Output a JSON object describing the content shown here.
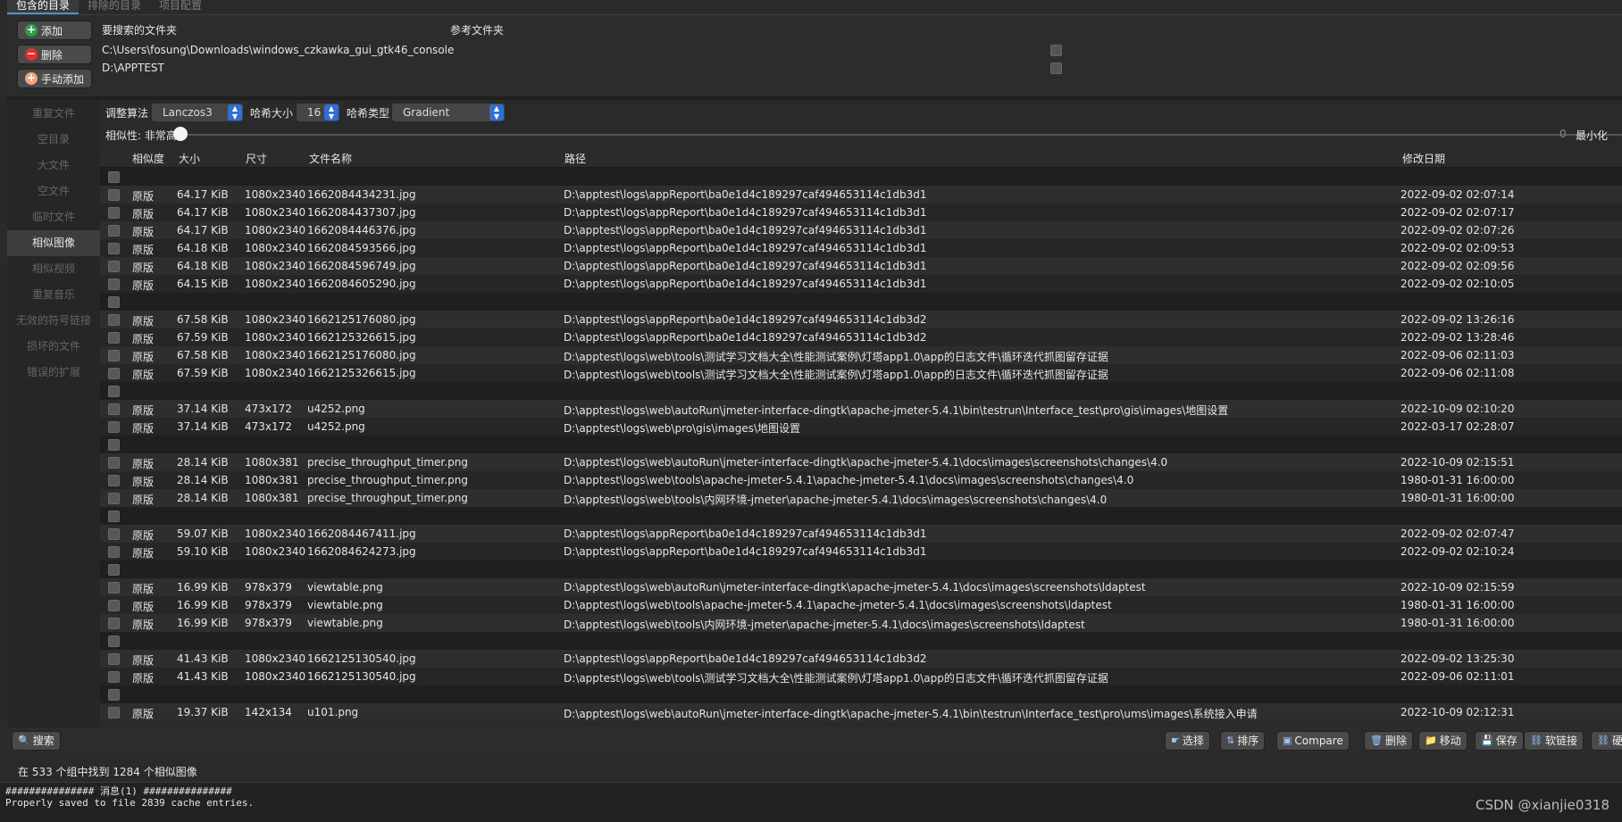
{
  "tabs": [
    "包含的目录",
    "排除的目录",
    "项目配置"
  ],
  "top": {
    "buttons": {
      "add": "添加",
      "remove": "删除",
      "manual_add": "手动添加"
    },
    "col_search": "要搜索的文件夹",
    "col_ref": "参考文件夹",
    "folders": [
      "C:\\Users\\fosung\\Downloads\\windows_czkawka_gui_gtk46_console",
      "D:\\APPTEST"
    ]
  },
  "sidebar": [
    "重复文件",
    "空目录",
    "大文件",
    "空文件",
    "临时文件",
    "相似图像",
    "相似视频",
    "重复音乐",
    "无效的符号链接",
    "损坏的文件",
    "错误的扩展"
  ],
  "options": {
    "resize_label": "调整算法",
    "resize_value": "Lanczos3",
    "hash_size_label": "哈希大小",
    "hash_size_value": "16",
    "hash_type_label": "哈希类型",
    "hash_type_value": "Gradient",
    "similarity_label": "相似性: 非常高",
    "slider_value": "0",
    "minimize_label": "最小化"
  },
  "columns": [
    "相似度",
    "大小",
    "尺寸",
    "文件名称",
    "路径",
    "修改日期"
  ],
  "rows": [
    {
      "h": true
    },
    {
      "sim": "原版",
      "size": "64.17 KiB",
      "dim": "1080x2340",
      "name": "1662084434231.jpg",
      "path": "D:\\apptest\\logs\\appReport\\ba0e1d4c189297caf494653114c1db3d1",
      "date": "2022-09-02 02:07:14"
    },
    {
      "sim": "原版",
      "size": "64.17 KiB",
      "dim": "1080x2340",
      "name": "1662084437307.jpg",
      "path": "D:\\apptest\\logs\\appReport\\ba0e1d4c189297caf494653114c1db3d1",
      "date": "2022-09-02 02:07:17"
    },
    {
      "sim": "原版",
      "size": "64.17 KiB",
      "dim": "1080x2340",
      "name": "1662084446376.jpg",
      "path": "D:\\apptest\\logs\\appReport\\ba0e1d4c189297caf494653114c1db3d1",
      "date": "2022-09-02 02:07:26"
    },
    {
      "sim": "原版",
      "size": "64.18 KiB",
      "dim": "1080x2340",
      "name": "1662084593566.jpg",
      "path": "D:\\apptest\\logs\\appReport\\ba0e1d4c189297caf494653114c1db3d1",
      "date": "2022-09-02 02:09:53"
    },
    {
      "sim": "原版",
      "size": "64.18 KiB",
      "dim": "1080x2340",
      "name": "1662084596749.jpg",
      "path": "D:\\apptest\\logs\\appReport\\ba0e1d4c189297caf494653114c1db3d1",
      "date": "2022-09-02 02:09:56"
    },
    {
      "sim": "原版",
      "size": "64.15 KiB",
      "dim": "1080x2340",
      "name": "1662084605290.jpg",
      "path": "D:\\apptest\\logs\\appReport\\ba0e1d4c189297caf494653114c1db3d1",
      "date": "2022-09-02 02:10:05"
    },
    {
      "h": true
    },
    {
      "sim": "原版",
      "size": "67.58 KiB",
      "dim": "1080x2340",
      "name": "1662125176080.jpg",
      "path": "D:\\apptest\\logs\\appReport\\ba0e1d4c189297caf494653114c1db3d2",
      "date": "2022-09-02 13:26:16"
    },
    {
      "sim": "原版",
      "size": "67.59 KiB",
      "dim": "1080x2340",
      "name": "1662125326615.jpg",
      "path": "D:\\apptest\\logs\\appReport\\ba0e1d4c189297caf494653114c1db3d2",
      "date": "2022-09-02 13:28:46"
    },
    {
      "sim": "原版",
      "size": "67.58 KiB",
      "dim": "1080x2340",
      "name": "1662125176080.jpg",
      "path": "D:\\apptest\\logs\\web\\tools\\测试学习文档大全\\性能测试案例\\灯塔app1.0\\app的日志文件\\循环迭代抓图留存证据",
      "date": "2022-09-06 02:11:03"
    },
    {
      "sim": "原版",
      "size": "67.59 KiB",
      "dim": "1080x2340",
      "name": "1662125326615.jpg",
      "path": "D:\\apptest\\logs\\web\\tools\\测试学习文档大全\\性能测试案例\\灯塔app1.0\\app的日志文件\\循环迭代抓图留存证据",
      "date": "2022-09-06 02:11:08"
    },
    {
      "h": true
    },
    {
      "sim": "原版",
      "size": "37.14 KiB",
      "dim": "473x172",
      "name": "u4252.png",
      "path": "D:\\apptest\\logs\\web\\autoRun\\jmeter-interface-dingtk\\apache-jmeter-5.4.1\\bin\\testrun\\Interface_test\\pro\\gis\\images\\地图设置",
      "date": "2022-10-09 02:10:20"
    },
    {
      "sim": "原版",
      "size": "37.14 KiB",
      "dim": "473x172",
      "name": "u4252.png",
      "path": "D:\\apptest\\logs\\web\\pro\\gis\\images\\地图设置",
      "date": "2022-03-17 02:28:07"
    },
    {
      "h": true
    },
    {
      "sim": "原版",
      "size": "28.14 KiB",
      "dim": "1080x381",
      "name": "precise_throughput_timer.png",
      "path": "D:\\apptest\\logs\\web\\autoRun\\jmeter-interface-dingtk\\apache-jmeter-5.4.1\\docs\\images\\screenshots\\changes\\4.0",
      "date": "2022-10-09 02:15:51"
    },
    {
      "sim": "原版",
      "size": "28.14 KiB",
      "dim": "1080x381",
      "name": "precise_throughput_timer.png",
      "path": "D:\\apptest\\logs\\web\\tools\\apache-jmeter-5.4.1\\apache-jmeter-5.4.1\\docs\\images\\screenshots\\changes\\4.0",
      "date": "1980-01-31 16:00:00"
    },
    {
      "sim": "原版",
      "size": "28.14 KiB",
      "dim": "1080x381",
      "name": "precise_throughput_timer.png",
      "path": "D:\\apptest\\logs\\web\\tools\\内网环境-jmeter\\apache-jmeter-5.4.1\\docs\\images\\screenshots\\changes\\4.0",
      "date": "1980-01-31 16:00:00"
    },
    {
      "h": true
    },
    {
      "sim": "原版",
      "size": "59.07 KiB",
      "dim": "1080x2340",
      "name": "1662084467411.jpg",
      "path": "D:\\apptest\\logs\\appReport\\ba0e1d4c189297caf494653114c1db3d1",
      "date": "2022-09-02 02:07:47"
    },
    {
      "sim": "原版",
      "size": "59.10 KiB",
      "dim": "1080x2340",
      "name": "1662084624273.jpg",
      "path": "D:\\apptest\\logs\\appReport\\ba0e1d4c189297caf494653114c1db3d1",
      "date": "2022-09-02 02:10:24"
    },
    {
      "h": true
    },
    {
      "sim": "原版",
      "size": "16.99 KiB",
      "dim": "978x379",
      "name": "viewtable.png",
      "path": "D:\\apptest\\logs\\web\\autoRun\\jmeter-interface-dingtk\\apache-jmeter-5.4.1\\docs\\images\\screenshots\\ldaptest",
      "date": "2022-10-09 02:15:59"
    },
    {
      "sim": "原版",
      "size": "16.99 KiB",
      "dim": "978x379",
      "name": "viewtable.png",
      "path": "D:\\apptest\\logs\\web\\tools\\apache-jmeter-5.4.1\\apache-jmeter-5.4.1\\docs\\images\\screenshots\\ldaptest",
      "date": "1980-01-31 16:00:00"
    },
    {
      "sim": "原版",
      "size": "16.99 KiB",
      "dim": "978x379",
      "name": "viewtable.png",
      "path": "D:\\apptest\\logs\\web\\tools\\内网环境-jmeter\\apache-jmeter-5.4.1\\docs\\images\\screenshots\\ldaptest",
      "date": "1980-01-31 16:00:00"
    },
    {
      "h": true
    },
    {
      "sim": "原版",
      "size": "41.43 KiB",
      "dim": "1080x2340",
      "name": "1662125130540.jpg",
      "path": "D:\\apptest\\logs\\appReport\\ba0e1d4c189297caf494653114c1db3d2",
      "date": "2022-09-02 13:25:30"
    },
    {
      "sim": "原版",
      "size": "41.43 KiB",
      "dim": "1080x2340",
      "name": "1662125130540.jpg",
      "path": "D:\\apptest\\logs\\web\\tools\\测试学习文档大全\\性能测试案例\\灯塔app1.0\\app的日志文件\\循环迭代抓图留存证据",
      "date": "2022-09-06 02:11:01"
    },
    {
      "h": true
    },
    {
      "sim": "原版",
      "size": "19.37 KiB",
      "dim": "142x134",
      "name": "u101.png",
      "path": "D:\\apptest\\logs\\web\\autoRun\\jmeter-interface-dingtk\\apache-jmeter-5.4.1\\bin\\testrun\\Interface_test\\pro\\ums\\images\\系统接入申请",
      "date": "2022-10-09 02:12:31"
    }
  ],
  "bottom": {
    "search": "搜索",
    "select": "选择",
    "sort": "排序",
    "compare": "Compare",
    "delete": "删除",
    "move": "移动",
    "save": "保存",
    "symlink": "软链接",
    "hardlink": "硬"
  },
  "status": "在 533 个组中找到 1284 个相似图像",
  "console": [
    "############### 消息(1) ###############",
    "Properly saved to file 2839 cache entries."
  ],
  "watermark": "CSDN @xianjie0318"
}
